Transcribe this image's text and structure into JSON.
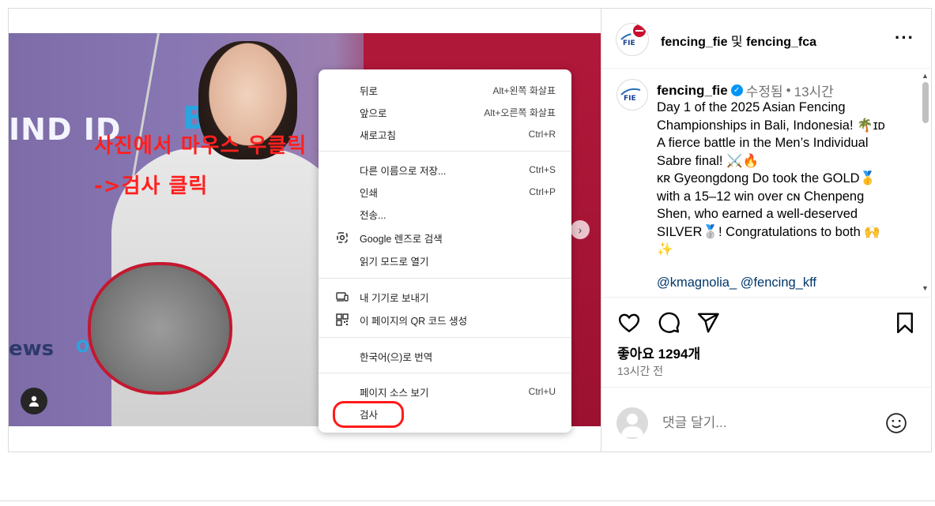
{
  "post": {
    "photo_text": {
      "sponsor_left": "IND ID",
      "sponsor_blue": "B",
      "sponsor_news": "ews",
      "sponsor_oke": "OKEz"
    },
    "annotation": {
      "line1": "사진에서 마우스 우클릭",
      "line2": "->검사 클릭"
    }
  },
  "context_menu": {
    "items": [
      {
        "label": "뒤로",
        "shortcut": "Alt+왼쪽 화살표",
        "icon": ""
      },
      {
        "label": "앞으로",
        "shortcut": "Alt+오른쪽 화살표",
        "icon": ""
      },
      {
        "label": "새로고침",
        "shortcut": "Ctrl+R",
        "icon": ""
      },
      {
        "label": "다른 이름으로 저장...",
        "shortcut": "Ctrl+S",
        "icon": ""
      },
      {
        "label": "인쇄",
        "shortcut": "Ctrl+P",
        "icon": ""
      },
      {
        "label": "전송...",
        "shortcut": "",
        "icon": ""
      },
      {
        "label": "Google 렌즈로 검색",
        "shortcut": "",
        "icon": "lens-icon"
      },
      {
        "label": "읽기 모드로 열기",
        "shortcut": "",
        "icon": ""
      },
      {
        "label": "내 기기로 보내기",
        "shortcut": "",
        "icon": "device-icon"
      },
      {
        "label": "이 페이지의 QR 코드 생성",
        "shortcut": "",
        "icon": "qr-code-icon"
      },
      {
        "label": "한국어(으)로 번역",
        "shortcut": "",
        "icon": ""
      },
      {
        "label": "페이지 소스 보기",
        "shortcut": "Ctrl+U",
        "icon": ""
      },
      {
        "label": "검사",
        "shortcut": "",
        "icon": ""
      }
    ]
  },
  "header": {
    "user1": "fencing_fie",
    "conjunction": "및",
    "user2": "fencing_fca",
    "more_icon": "more-icon"
  },
  "caption": {
    "username": "fencing_fie",
    "edited": "수정됨",
    "separator": "•",
    "time": "13시간",
    "text": "Day 1 of the 2025 Asian Fencing\nChampionships in Bali, Indonesia! 🌴ɪᴅ\nA fierce battle in the Men’s Individual\nSabre final! ⚔️🔥\nᴋʀ Gyeongdong Do took the GOLD🥇\nwith a 15–12 win over ᴄɴ Chenpeng\nShen, who earned a well-deserved\nSILVER🥈! Congratulations to both 🙌\n✨",
    "mentions": "@kmagnolia_ @fencing_kff"
  },
  "actions": {
    "likes": "좋아요 1294개",
    "time": "13시간 전",
    "icons": [
      "heart-icon",
      "comment-icon",
      "share-icon",
      "bookmark-icon"
    ]
  },
  "comment": {
    "placeholder": "댓글 달기...",
    "emoji_icon": "emoji-icon"
  },
  "colors": {
    "annotation": "#ff2020",
    "link": "#00376b",
    "verified": "#0095f6",
    "muted": "#737373"
  }
}
